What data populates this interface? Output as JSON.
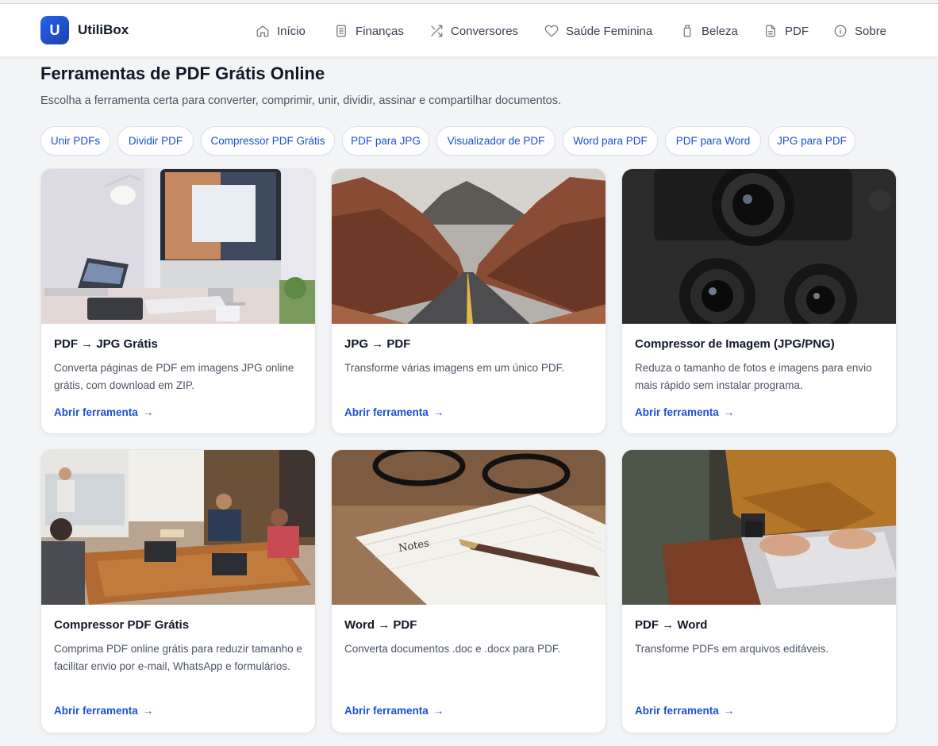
{
  "brand": {
    "badge": "U",
    "name": "UtiliBox"
  },
  "nav": [
    {
      "label": "Início",
      "icon": "home-icon"
    },
    {
      "label": "Finanças",
      "icon": "document-list-icon"
    },
    {
      "label": "Conversores",
      "icon": "shuffle-icon"
    },
    {
      "label": "Saúde Feminina",
      "icon": "heart-icon"
    },
    {
      "label": "Beleza",
      "icon": "bottle-icon"
    },
    {
      "label": "PDF",
      "icon": "file-icon"
    },
    {
      "label": "Sobre",
      "icon": "info-icon"
    }
  ],
  "page": {
    "title": "Ferramentas de PDF Grátis Online",
    "subtitle": "Escolha a ferramenta certa para converter, comprimir, unir, dividir, assinar e compartilhar documentos."
  },
  "chips": [
    "Unir PDFs",
    "Dividir PDF",
    "Compressor PDF Grátis",
    "PDF para JPG",
    "Visualizador de PDF",
    "Word para PDF",
    "PDF para Word",
    "JPG para PDF"
  ],
  "cards": [
    {
      "title": "PDF → JPG Grátis",
      "desc": "Converta páginas de PDF em imagens JPG online grátis, com download em ZIP.",
      "link": "Abrir ferramenta",
      "arrow": "→",
      "image": "desk-computer-photo"
    },
    {
      "title": "JPG → PDF",
      "desc": "Transforme várias imagens em um único PDF.",
      "link": "Abrir ferramenta",
      "arrow": "→",
      "image": "desert-road-photo"
    },
    {
      "title": "Compressor de Imagem (JPG/PNG)",
      "desc": "Reduza o tamanho de fotos e imagens para envio mais rápido sem instalar programa.",
      "link": "Abrir ferramenta",
      "arrow": "→",
      "image": "camera-lenses-photo"
    },
    {
      "title": "Compressor PDF Grátis",
      "desc": "Comprima PDF online grátis para reduzir tamanho e facilitar envio por e-mail, WhatsApp e formulários.",
      "link": "Abrir ferramenta",
      "arrow": "→",
      "image": "meeting-room-photo"
    },
    {
      "title": "Word → PDF",
      "desc": "Converta documentos .doc e .docx para PDF.",
      "link": "Abrir ferramenta",
      "arrow": "→",
      "image": "notebook-pen-photo"
    },
    {
      "title": "PDF → Word",
      "desc": "Transforme PDFs em arquivos editáveis.",
      "link": "Abrir ferramenta",
      "arrow": "→",
      "image": "laptop-typing-photo"
    }
  ],
  "colors": {
    "accent": "#1d4ed8",
    "background": "#f3f4f6",
    "card": "#ffffff"
  }
}
